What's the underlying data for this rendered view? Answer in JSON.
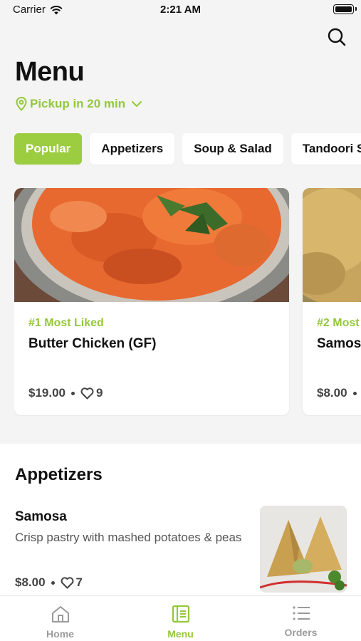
{
  "status": {
    "carrier": "Carrier",
    "time": "2:21 AM"
  },
  "header": {
    "title": "Menu",
    "pickup": "Pickup in 20 min"
  },
  "tabs": [
    {
      "label": "Popular",
      "active": true
    },
    {
      "label": "Appetizers",
      "active": false
    },
    {
      "label": "Soup & Salad",
      "active": false
    },
    {
      "label": "Tandoori S",
      "active": false
    }
  ],
  "featured": [
    {
      "rank": "#1 Most Liked",
      "name": "Butter Chicken (GF)",
      "price": "$19.00",
      "likes": "9"
    },
    {
      "rank": "#2 Most",
      "name": "Samos",
      "price": "$8.00",
      "likes": ""
    }
  ],
  "section": {
    "title": "Appetizers",
    "item": {
      "name": "Samosa",
      "description": "Crisp pastry with mashed potatoes & peas",
      "price": "$8.00",
      "likes": "7"
    }
  },
  "bottom_nav": [
    {
      "label": "Home",
      "icon": "home-icon",
      "active": false
    },
    {
      "label": "Menu",
      "icon": "menu-book-icon",
      "active": true
    },
    {
      "label": "Orders",
      "icon": "list-icon",
      "active": false
    }
  ],
  "colors": {
    "accent": "#9ccc3f",
    "accent_text": "#93c83a",
    "background": "#f4f4f4"
  }
}
